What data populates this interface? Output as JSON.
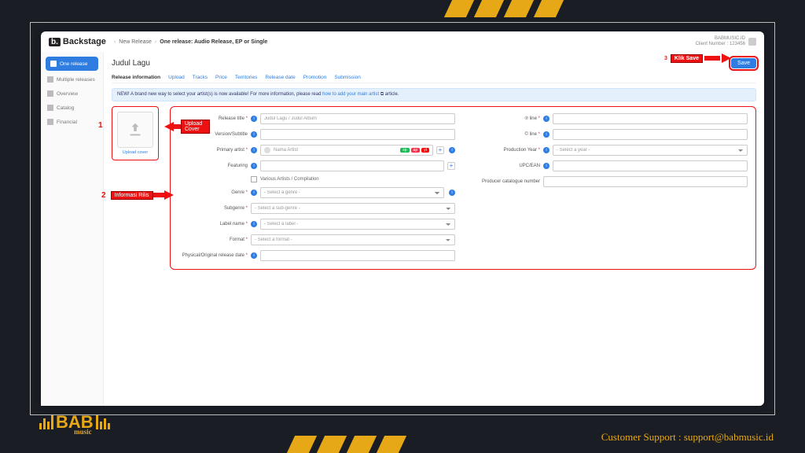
{
  "logo": "Backstage",
  "breadcrumb": {
    "item1": "New Release",
    "item2": "One release: Audio Release, EP or Single"
  },
  "user": {
    "name": "BABMUSIC.ID",
    "client": "Client Number : 123456"
  },
  "sidebar": {
    "items": [
      {
        "label": "One release"
      },
      {
        "label": "Multiple releases"
      },
      {
        "label": "Overview"
      },
      {
        "label": "Catalog"
      },
      {
        "label": "Financial"
      }
    ]
  },
  "page_title": "Judul Lagu",
  "save_label": "Save",
  "annot": {
    "a1_num": "1",
    "a1_label": "Upload Cover",
    "a2_num": "2",
    "a2_label": "Informasi Rilis",
    "a3_num": "3",
    "a3_label": "Klik Save"
  },
  "tabs": [
    "Release information",
    "Upload",
    "Tracks",
    "Price",
    "Territories",
    "Release date",
    "Promotion",
    "Submission"
  ],
  "banner": {
    "pre": "NEW! A brand new way to select your artist(s) is now available! For more information, please read ",
    "link": "how to add your main artist",
    "suf": " ⧉ article."
  },
  "cover_label": "Upload cover",
  "form": {
    "left": {
      "release_title": {
        "label": "Release title",
        "value": "Judul Lagu / Judul Album"
      },
      "version": {
        "label": "Version/Subtitle",
        "value": ""
      },
      "primary_artist": {
        "label": "Primary artist",
        "value": "Nama Artist"
      },
      "featuring": {
        "label": "Featuring",
        "value": ""
      },
      "various": "Various Artists / Compilation",
      "genre": {
        "label": "Genre",
        "value": "- Select a genre -"
      },
      "subgenre": {
        "label": "Subgenre",
        "value": "- Select a sub-genre -"
      },
      "label_name": {
        "label": "Label name",
        "value": "- Select a label -"
      },
      "format": {
        "label": "Format",
        "value": "- Select a format -"
      },
      "phys_date": {
        "label": "Physical/Original release date",
        "value": ""
      }
    },
    "right": {
      "pline": {
        "label": "℗ line",
        "value": ""
      },
      "cline": {
        "label": "© line",
        "value": ""
      },
      "year": {
        "label": "Production Year",
        "value": "- Select a year -"
      },
      "upc": {
        "label": "UPC/EAN",
        "value": ""
      },
      "catno": {
        "label": "Producer catalogue number",
        "value": ""
      }
    }
  },
  "footer": "Customer Support : support@babmusic.id",
  "bab": {
    "big": "BAB",
    "sub": "music"
  }
}
